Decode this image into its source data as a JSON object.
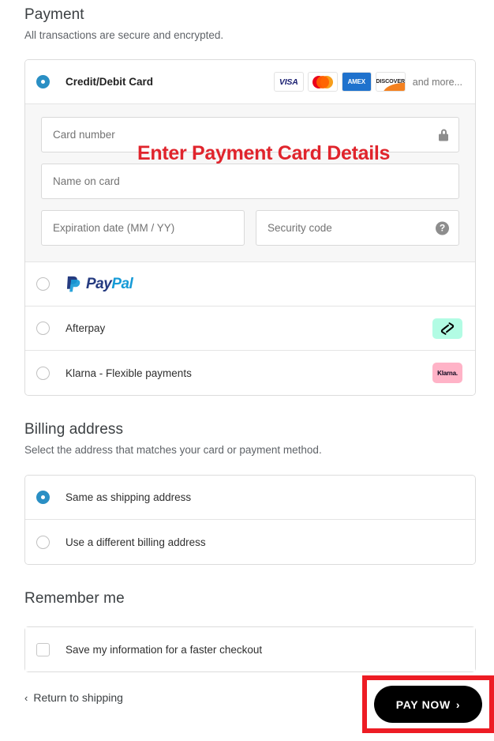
{
  "payment": {
    "title": "Payment",
    "subtitle": "All transactions are secure and encrypted.",
    "methods": [
      {
        "label": "Credit/Debit Card",
        "selected": true
      },
      {
        "label": "PayPal",
        "selected": false
      },
      {
        "label": "Afterpay",
        "selected": false
      },
      {
        "label": "Klarna - Flexible payments",
        "selected": false
      }
    ],
    "card_brands": [
      "VISA",
      "MASTERCARD",
      "AMEX",
      "DISCOVER"
    ],
    "brand_text": {
      "visa": "VISA",
      "amex": "AMEX",
      "discover": "DISCOVER"
    },
    "and_more": "and more...",
    "fields": {
      "card_number": {
        "placeholder": "Card number",
        "value": ""
      },
      "name_on_card": {
        "placeholder": "Name on card",
        "value": ""
      },
      "expiration": {
        "placeholder": "Expiration date (MM / YY)",
        "value": ""
      },
      "security_code": {
        "placeholder": "Security code",
        "value": ""
      }
    },
    "paypal_logo": {
      "pay": "Pay",
      "pal": "Pal"
    },
    "klarna_badge": "Klarna."
  },
  "billing": {
    "title": "Billing address",
    "subtitle": "Select the address that matches your card or payment method.",
    "options": [
      {
        "label": "Same as shipping address",
        "selected": true
      },
      {
        "label": "Use a different billing address",
        "selected": false
      }
    ]
  },
  "remember": {
    "title": "Remember me",
    "checkbox_label": "Save my information for a faster checkout",
    "checked": false
  },
  "footer": {
    "return_link": "Return to shipping",
    "back_chevron": "‹",
    "pay_now": "PAY NOW",
    "pay_chevron": "›"
  },
  "annotation": {
    "text": "Enter Payment Card Details",
    "color": "#e0242c",
    "highlight_color": "#ed1c24"
  },
  "colors": {
    "accent_radio": "#2a8fc4",
    "afterpay_bg": "#b2fce4",
    "klarna_bg": "#ffb3c7",
    "paypal_dark": "#253b80",
    "paypal_light": "#179bd7",
    "button_bg": "#000000"
  }
}
